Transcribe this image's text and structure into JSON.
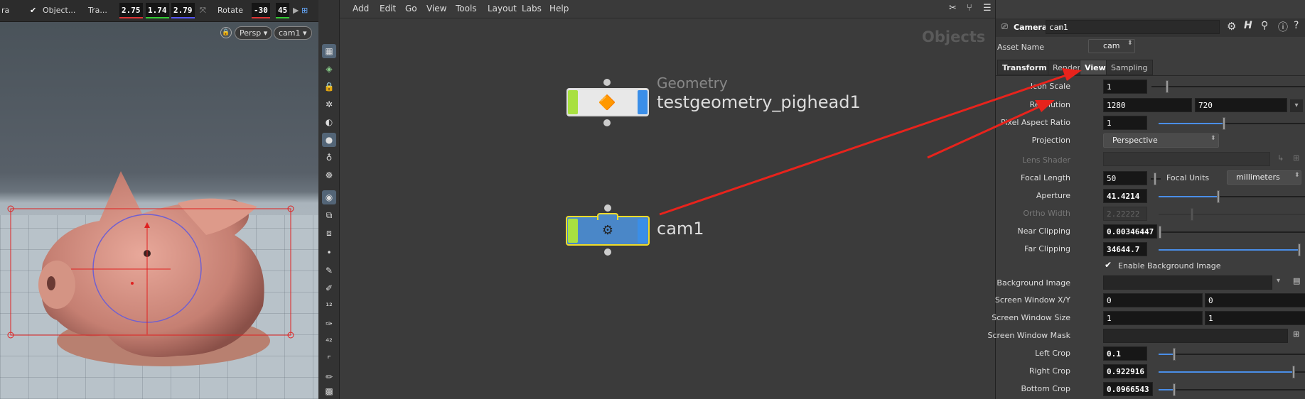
{
  "viewport": {
    "cam_label": "ra",
    "object_menu": "Object...",
    "transform_label": "Tra...",
    "translate": [
      "2.75",
      "1.74",
      "2.79"
    ],
    "rotate_label": "Rotate",
    "rotate": [
      "-30",
      "45"
    ],
    "persp": "Persp ▾",
    "cam_menu": "cam1 ▾"
  },
  "menubar": {
    "items": [
      "Add",
      "Edit",
      "Go",
      "View",
      "Tools",
      "Layout",
      "Labs",
      "Help"
    ]
  },
  "network": {
    "context_title": "Objects",
    "nodes": [
      {
        "type": "Geometry",
        "name": "testgeometry_pighead1"
      },
      {
        "type": "",
        "name": "cam1"
      }
    ]
  },
  "params": {
    "node_type": "Camera",
    "node_name": "cam1",
    "asset_name_label": "Asset Name",
    "asset_name": "cam",
    "tabs": [
      "Transform",
      "Render",
      "View",
      "Sampling"
    ],
    "active_tab": "View",
    "rows": {
      "icon_scale": {
        "label": "Icon Scale",
        "value": "1"
      },
      "resolution": {
        "label": "Resolution",
        "x": "1280",
        "y": "720"
      },
      "pixel_aspect": {
        "label": "Pixel Aspect Ratio",
        "value": "1"
      },
      "projection": {
        "label": "Projection",
        "value": "Perspective"
      },
      "lens_shader": {
        "label": "Lens Shader",
        "value": ""
      },
      "focal_length": {
        "label": "Focal Length",
        "value": "50",
        "units_label": "Focal Units",
        "units": "millimeters"
      },
      "aperture": {
        "label": "Aperture",
        "value": "41.4214"
      },
      "ortho_width": {
        "label": "Ortho Width",
        "value": "2.22222"
      },
      "near_clipping": {
        "label": "Near Clipping",
        "value": "0.00346447"
      },
      "far_clipping": {
        "label": "Far Clipping",
        "value": "34644.7"
      },
      "enable_bg": {
        "label": "Enable Background Image"
      },
      "bg_image": {
        "label": "Background Image",
        "value": ""
      },
      "screen_window_xy": {
        "label": "Screen Window X/Y",
        "x": "0",
        "y": "0"
      },
      "screen_window_size": {
        "label": "Screen Window Size",
        "x": "1",
        "y": "1"
      },
      "screen_window_mask": {
        "label": "Screen Window Mask",
        "value": ""
      },
      "left_crop": {
        "label": "Left Crop",
        "value": "0.1"
      },
      "right_crop": {
        "label": "Right Crop",
        "value": "0.922916"
      },
      "bottom_crop": {
        "label": "Bottom Crop",
        "value": "0.0966543"
      }
    }
  },
  "colors": {
    "accent": "#4a8ee8",
    "arrow": "#e8231c",
    "selection": "#e02020",
    "node_blue": "#4a87c8",
    "node_green": "#a8e040"
  }
}
